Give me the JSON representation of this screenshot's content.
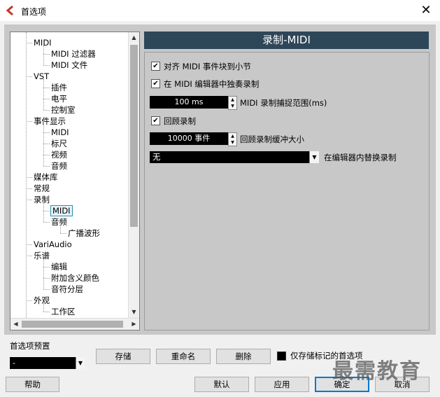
{
  "window": {
    "title": "首选项",
    "close_label": "✕"
  },
  "tree": {
    "items": [
      {
        "label": "MIDI",
        "level": 1
      },
      {
        "label": "MIDI 过滤器",
        "level": 2
      },
      {
        "label": "MIDI 文件",
        "level": 2
      },
      {
        "label": "VST",
        "level": 1
      },
      {
        "label": "插件",
        "level": 2
      },
      {
        "label": "电平",
        "level": 2
      },
      {
        "label": "控制室",
        "level": 2
      },
      {
        "label": "事件显示",
        "level": 1
      },
      {
        "label": "MIDI",
        "level": 2
      },
      {
        "label": "标尺",
        "level": 2
      },
      {
        "label": "视频",
        "level": 2
      },
      {
        "label": "音频",
        "level": 2
      },
      {
        "label": "媒体库",
        "level": 1
      },
      {
        "label": "常规",
        "level": 1
      },
      {
        "label": "录制",
        "level": 1
      },
      {
        "label": "MIDI",
        "level": 2,
        "selected": true
      },
      {
        "label": "音频",
        "level": 2
      },
      {
        "label": "广播波形",
        "level": 3
      },
      {
        "label": "VariAudio",
        "level": 1
      },
      {
        "label": "乐谱",
        "level": 1
      },
      {
        "label": "编辑",
        "level": 2
      },
      {
        "label": "附加含义颜色",
        "level": 2
      },
      {
        "label": "音符分层",
        "level": 2
      },
      {
        "label": "外观",
        "level": 1
      },
      {
        "label": "工作区",
        "level": 2
      }
    ]
  },
  "panel": {
    "title": "录制-MIDI",
    "snap_midi_events": {
      "label": "对齐 MIDI 事件块到小节",
      "checked": true
    },
    "solo_in_editor": {
      "label": "在 MIDI 编辑器中独奏录制",
      "checked": true
    },
    "capture_range": {
      "value": "100 ms",
      "label": "MIDI 录制捕捉范围(ms)"
    },
    "retro_record": {
      "label": "回顾录制",
      "checked": true
    },
    "retro_buffer": {
      "value": "10000 事件",
      "label": "回顾录制缓冲大小"
    },
    "replace_mode": {
      "value": "无",
      "label": "在编辑器内替换录制"
    }
  },
  "presets": {
    "label": "首选项预置",
    "selected": "-",
    "store_label": "存储",
    "rename_label": "重命名",
    "delete_label": "删除",
    "store_marked_only": {
      "label": "仅存储标记的首选项",
      "checked": false
    }
  },
  "footer": {
    "help_label": "帮助",
    "default_label": "默认",
    "apply_label": "应用",
    "ok_label": "确定",
    "cancel_label": "取消"
  },
  "watermark": "最需教育",
  "colors": {
    "header_bg": "#2e4758",
    "panel_bg": "#c8c8c8",
    "focus": "#0078d7",
    "selection": "#2a8fb5"
  }
}
